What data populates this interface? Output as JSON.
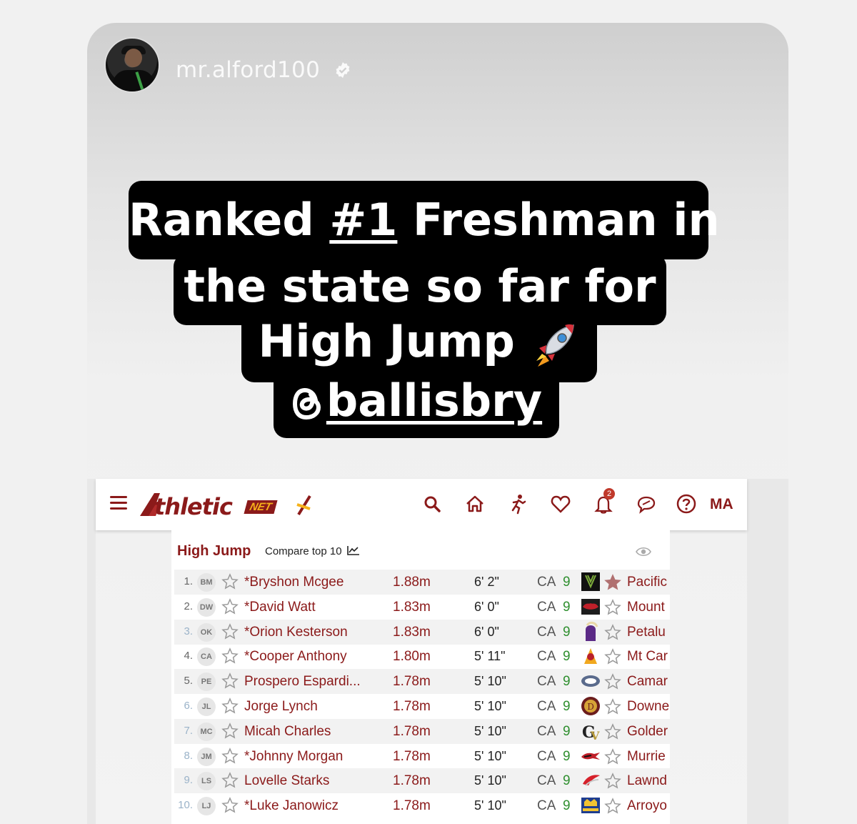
{
  "story": {
    "username": "mr.alford100",
    "caption_lines": [
      "Ranked ",
      "#1",
      " Freshman in",
      "the state so far for",
      "High Jump",
      "ballisbry"
    ]
  },
  "navbar": {
    "logo_main": "thletic",
    "logo_net": "NET",
    "notification_count": "2",
    "profile_initials": "MA",
    "icons": [
      "menu-icon",
      "search-icon",
      "home-icon",
      "runner-icon",
      "heart-icon",
      "bell-icon",
      "chat-icon",
      "help-icon"
    ]
  },
  "table": {
    "title": "High Jump",
    "compare_label": "Compare top 10",
    "rows": [
      {
        "rank": "1.",
        "initials": "BM",
        "name": "*Bryshon Mcgee",
        "metric": "1.88m",
        "imperial": "6' 2\"",
        "state": "CA",
        "grade": "9",
        "school": "Pacific"
      },
      {
        "rank": "2.",
        "initials": "DW",
        "name": "*David Watt",
        "metric": "1.83m",
        "imperial": "6' 0\"",
        "state": "CA",
        "grade": "9",
        "school": "Mount"
      },
      {
        "rank": "3.",
        "initials": "OK",
        "name": "*Orion Kesterson",
        "metric": "1.83m",
        "imperial": "6' 0\"",
        "state": "CA",
        "grade": "9",
        "school": "Petalu"
      },
      {
        "rank": "4.",
        "initials": "CA",
        "name": "*Cooper Anthony",
        "metric": "1.80m",
        "imperial": "5' 11\"",
        "state": "CA",
        "grade": "9",
        "school": "Mt Car"
      },
      {
        "rank": "5.",
        "initials": "PE",
        "name": "Prospero Espardi...",
        "metric": "1.78m",
        "imperial": "5' 10\"",
        "state": "CA",
        "grade": "9",
        "school": "Camar"
      },
      {
        "rank": "6.",
        "initials": "JL",
        "name": "Jorge Lynch",
        "metric": "1.78m",
        "imperial": "5' 10\"",
        "state": "CA",
        "grade": "9",
        "school": "Downe"
      },
      {
        "rank": "7.",
        "initials": "MC",
        "name": "Micah Charles",
        "metric": "1.78m",
        "imperial": "5' 10\"",
        "state": "CA",
        "grade": "9",
        "school": "Golder"
      },
      {
        "rank": "8.",
        "initials": "JM",
        "name": "*Johnny Morgan",
        "metric": "1.78m",
        "imperial": "5' 10\"",
        "state": "CA",
        "grade": "9",
        "school": "Murrie"
      },
      {
        "rank": "9.",
        "initials": "LS",
        "name": "Lovelle Starks",
        "metric": "1.78m",
        "imperial": "5' 10\"",
        "state": "CA",
        "grade": "9",
        "school": "Lawnd"
      },
      {
        "rank": "10.",
        "initials": "LJ",
        "name": "*Luke Janowicz",
        "metric": "1.78m",
        "imperial": "5' 10\"",
        "state": "CA",
        "grade": "9",
        "school": "Arroyo"
      }
    ]
  },
  "colors": {
    "brand": "#8b1a1a",
    "accent": "#f6b21a",
    "grade": "#2f8f2f",
    "caption_bg": "#000000"
  }
}
